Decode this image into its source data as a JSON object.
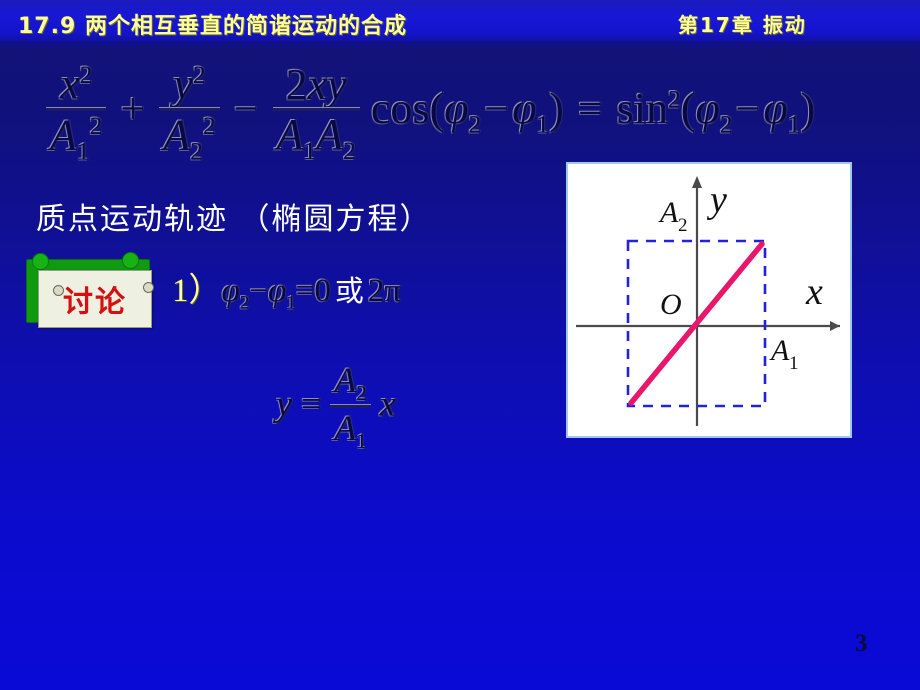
{
  "header": {
    "section_title": "17.9  两个相互垂直的简谐运动的合成",
    "chapter_title": "第17章   振动",
    "text_color": "#ffff99",
    "band_color": "#1717d6"
  },
  "slide": {
    "background_color": "#0e0eb4",
    "page_number": "3"
  },
  "main_equation": {
    "term1": {
      "numerator": "x",
      "numerator_exponent": "2",
      "denominator": "A",
      "denominator_sub": "1",
      "denominator_exponent": "2"
    },
    "operator1": "+",
    "term2": {
      "numerator": "y",
      "numerator_exponent": "2",
      "denominator": "A",
      "denominator_sub": "2",
      "denominator_exponent": "2"
    },
    "operator2": "−",
    "term3": {
      "numerator_coeff": "2",
      "numerator_vars": "xy",
      "denominator_a": "A",
      "denominator_a_sub": "1",
      "denominator_b": "A",
      "denominator_b_sub": "2"
    },
    "cos_open": "cos(",
    "phi": "φ",
    "phi2_sub": "2",
    "minus": "−",
    "phi1_sub": "1",
    "cos_close": ")",
    "equals": "=",
    "sin_name": "sin",
    "sin_exponent": "2",
    "sin_open": "(",
    "sin_close": ")"
  },
  "trajectory_caption": "质点运动轨迹  （椭圆方程）",
  "discussion": {
    "label": "讨论",
    "label_color": "#d61010",
    "frame_color": "#0f9a0f",
    "paper_color": "#eef0e2"
  },
  "case_one": {
    "number": "1）",
    "phi": "φ",
    "phi2_sub": "2",
    "minus": "−",
    "phi1_sub": "1",
    "equals": "=",
    "value_zero": "0",
    "or_word": "或",
    "value_two_pi": "2π"
  },
  "result_equation": {
    "lhs": "y",
    "equals": "=",
    "numerator": "A",
    "numerator_sub": "2",
    "denominator": "A",
    "denominator_sub": "1",
    "rhs_var": "x"
  },
  "figure": {
    "axis_x_label": "x",
    "axis_y_label": "y",
    "origin_label": "O",
    "amplitude_x_label": "A",
    "amplitude_x_sub": "1",
    "amplitude_y_label": "A",
    "amplitude_y_sub": "2",
    "line_color": "#e8176b",
    "box_color": "#2222dd",
    "axis_color": "#4a4a4a",
    "panel_background": "#ffffff"
  },
  "chart_data": {
    "type": "line",
    "title": "",
    "xlabel": "x",
    "ylabel": "y",
    "xlim": [
      -1.35,
      1.35
    ],
    "ylim": [
      -1.35,
      1.35
    ],
    "grid": false,
    "legend": "none",
    "annotations": [
      {
        "text": "O",
        "x": -0.18,
        "y": 0.16
      },
      {
        "text": "A1",
        "x": 1.12,
        "y": -0.28
      },
      {
        "text": "A2",
        "x": -0.38,
        "y": 1.18
      }
    ],
    "series": [
      {
        "name": "trajectory",
        "x": [
          -1.0,
          1.0
        ],
        "values": [
          -1.0,
          1.0
        ],
        "color": "#e8176b",
        "style": "solid",
        "width": 5
      },
      {
        "name": "bounding-box",
        "x": [
          -1.0,
          1.0,
          1.0,
          -1.0,
          -1.0
        ],
        "values": [
          -1.0,
          -1.0,
          1.0,
          1.0,
          -1.0
        ],
        "color": "#2222dd",
        "style": "dashed",
        "width": 2
      }
    ]
  }
}
